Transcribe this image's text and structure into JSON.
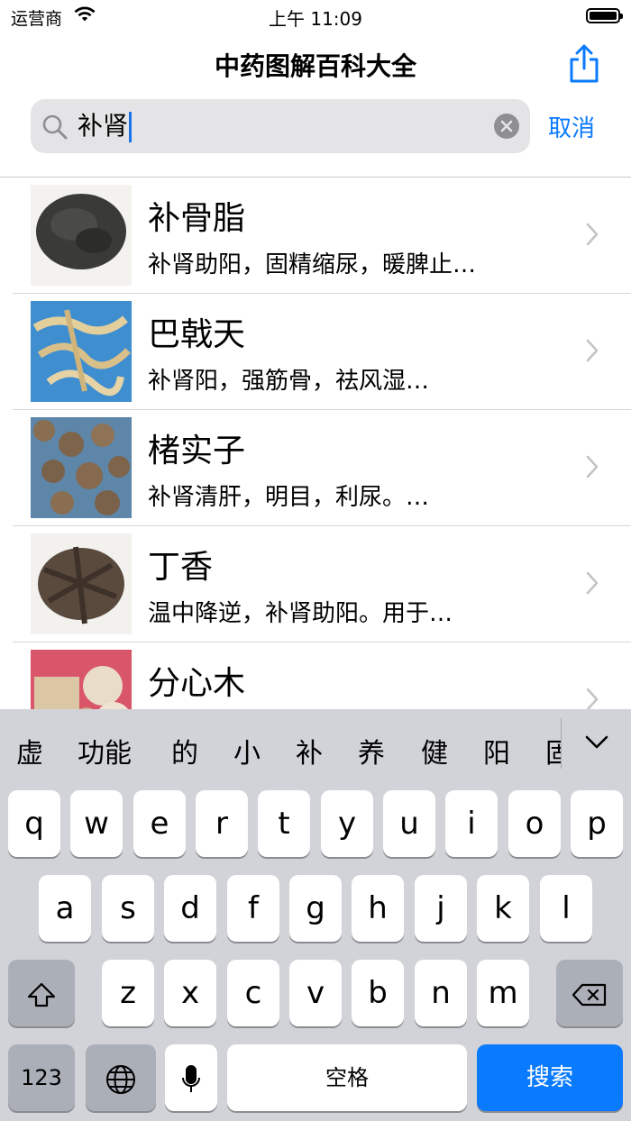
{
  "status": {
    "carrier": "运营商",
    "time": "上午 11:09"
  },
  "nav": {
    "title": "中药图解百科大全"
  },
  "search": {
    "query": "补肾",
    "cancel": "取消"
  },
  "results": [
    {
      "name": "补骨脂",
      "desc": "补肾助阳，固精缩尿，暖脾止…"
    },
    {
      "name": "巴戟天",
      "desc": "补肾阳，强筋骨，祛风湿…"
    },
    {
      "name": "楮实子",
      "desc": "补肾清肝，明目，利尿。…"
    },
    {
      "name": "丁香",
      "desc": "温中降逆，补肾助阳。用于…"
    },
    {
      "name": "分心木",
      "desc": ""
    }
  ],
  "keyboard": {
    "candidates": [
      "虚",
      "功能",
      "的",
      "小",
      "补",
      "养",
      "健",
      "阳",
      "固"
    ],
    "row1": [
      "q",
      "w",
      "e",
      "r",
      "t",
      "y",
      "u",
      "i",
      "o",
      "p"
    ],
    "row2": [
      "a",
      "s",
      "d",
      "f",
      "g",
      "h",
      "j",
      "k",
      "l"
    ],
    "row3": [
      "z",
      "x",
      "c",
      "v",
      "b",
      "n",
      "m"
    ],
    "numbers": "123",
    "space": "空格",
    "search": "搜索"
  },
  "colors": {
    "accent": "#0a7aff",
    "keyboard_bg": "#d1d3d9"
  }
}
